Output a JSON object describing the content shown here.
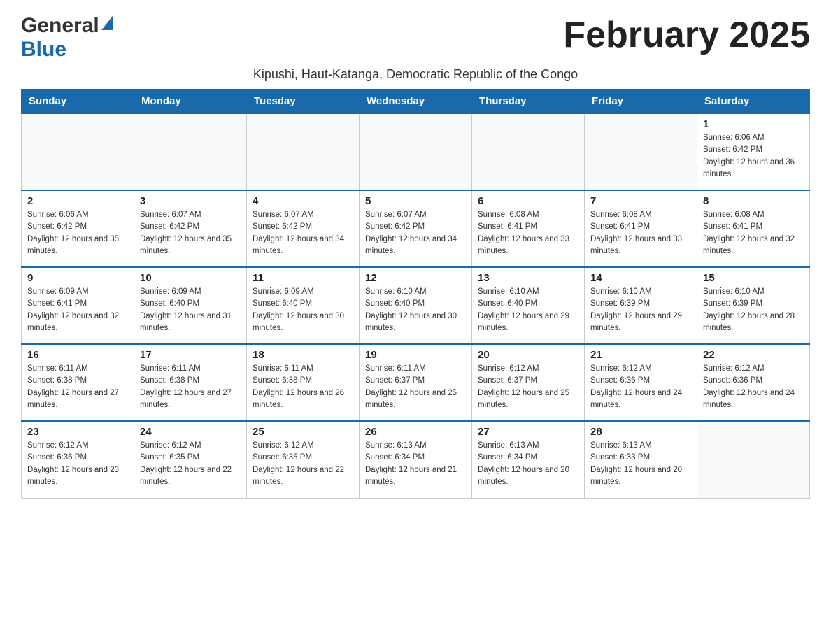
{
  "header": {
    "logo_general": "General",
    "logo_blue": "Blue",
    "month_title": "February 2025",
    "subtitle": "Kipushi, Haut-Katanga, Democratic Republic of the Congo"
  },
  "days_of_week": [
    "Sunday",
    "Monday",
    "Tuesday",
    "Wednesday",
    "Thursday",
    "Friday",
    "Saturday"
  ],
  "weeks": [
    [
      {
        "day": "",
        "info": ""
      },
      {
        "day": "",
        "info": ""
      },
      {
        "day": "",
        "info": ""
      },
      {
        "day": "",
        "info": ""
      },
      {
        "day": "",
        "info": ""
      },
      {
        "day": "",
        "info": ""
      },
      {
        "day": "1",
        "info": "Sunrise: 6:06 AM\nSunset: 6:42 PM\nDaylight: 12 hours and 36 minutes."
      }
    ],
    [
      {
        "day": "2",
        "info": "Sunrise: 6:06 AM\nSunset: 6:42 PM\nDaylight: 12 hours and 35 minutes."
      },
      {
        "day": "3",
        "info": "Sunrise: 6:07 AM\nSunset: 6:42 PM\nDaylight: 12 hours and 35 minutes."
      },
      {
        "day": "4",
        "info": "Sunrise: 6:07 AM\nSunset: 6:42 PM\nDaylight: 12 hours and 34 minutes."
      },
      {
        "day": "5",
        "info": "Sunrise: 6:07 AM\nSunset: 6:42 PM\nDaylight: 12 hours and 34 minutes."
      },
      {
        "day": "6",
        "info": "Sunrise: 6:08 AM\nSunset: 6:41 PM\nDaylight: 12 hours and 33 minutes."
      },
      {
        "day": "7",
        "info": "Sunrise: 6:08 AM\nSunset: 6:41 PM\nDaylight: 12 hours and 33 minutes."
      },
      {
        "day": "8",
        "info": "Sunrise: 6:08 AM\nSunset: 6:41 PM\nDaylight: 12 hours and 32 minutes."
      }
    ],
    [
      {
        "day": "9",
        "info": "Sunrise: 6:09 AM\nSunset: 6:41 PM\nDaylight: 12 hours and 32 minutes."
      },
      {
        "day": "10",
        "info": "Sunrise: 6:09 AM\nSunset: 6:40 PM\nDaylight: 12 hours and 31 minutes."
      },
      {
        "day": "11",
        "info": "Sunrise: 6:09 AM\nSunset: 6:40 PM\nDaylight: 12 hours and 30 minutes."
      },
      {
        "day": "12",
        "info": "Sunrise: 6:10 AM\nSunset: 6:40 PM\nDaylight: 12 hours and 30 minutes."
      },
      {
        "day": "13",
        "info": "Sunrise: 6:10 AM\nSunset: 6:40 PM\nDaylight: 12 hours and 29 minutes."
      },
      {
        "day": "14",
        "info": "Sunrise: 6:10 AM\nSunset: 6:39 PM\nDaylight: 12 hours and 29 minutes."
      },
      {
        "day": "15",
        "info": "Sunrise: 6:10 AM\nSunset: 6:39 PM\nDaylight: 12 hours and 28 minutes."
      }
    ],
    [
      {
        "day": "16",
        "info": "Sunrise: 6:11 AM\nSunset: 6:38 PM\nDaylight: 12 hours and 27 minutes."
      },
      {
        "day": "17",
        "info": "Sunrise: 6:11 AM\nSunset: 6:38 PM\nDaylight: 12 hours and 27 minutes."
      },
      {
        "day": "18",
        "info": "Sunrise: 6:11 AM\nSunset: 6:38 PM\nDaylight: 12 hours and 26 minutes."
      },
      {
        "day": "19",
        "info": "Sunrise: 6:11 AM\nSunset: 6:37 PM\nDaylight: 12 hours and 25 minutes."
      },
      {
        "day": "20",
        "info": "Sunrise: 6:12 AM\nSunset: 6:37 PM\nDaylight: 12 hours and 25 minutes."
      },
      {
        "day": "21",
        "info": "Sunrise: 6:12 AM\nSunset: 6:36 PM\nDaylight: 12 hours and 24 minutes."
      },
      {
        "day": "22",
        "info": "Sunrise: 6:12 AM\nSunset: 6:36 PM\nDaylight: 12 hours and 24 minutes."
      }
    ],
    [
      {
        "day": "23",
        "info": "Sunrise: 6:12 AM\nSunset: 6:36 PM\nDaylight: 12 hours and 23 minutes."
      },
      {
        "day": "24",
        "info": "Sunrise: 6:12 AM\nSunset: 6:35 PM\nDaylight: 12 hours and 22 minutes."
      },
      {
        "day": "25",
        "info": "Sunrise: 6:12 AM\nSunset: 6:35 PM\nDaylight: 12 hours and 22 minutes."
      },
      {
        "day": "26",
        "info": "Sunrise: 6:13 AM\nSunset: 6:34 PM\nDaylight: 12 hours and 21 minutes."
      },
      {
        "day": "27",
        "info": "Sunrise: 6:13 AM\nSunset: 6:34 PM\nDaylight: 12 hours and 20 minutes."
      },
      {
        "day": "28",
        "info": "Sunrise: 6:13 AM\nSunset: 6:33 PM\nDaylight: 12 hours and 20 minutes."
      },
      {
        "day": "",
        "info": ""
      }
    ]
  ]
}
